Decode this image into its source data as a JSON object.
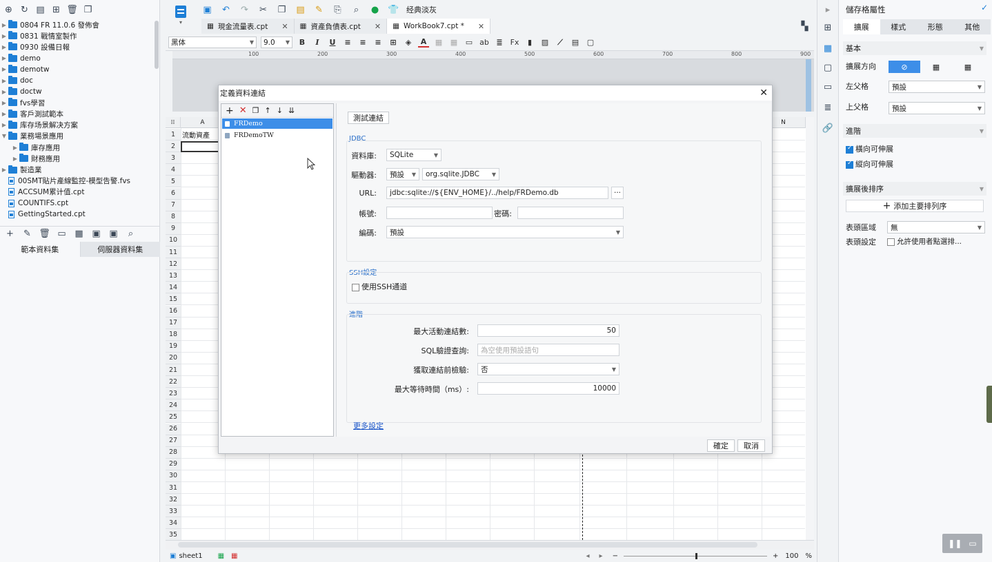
{
  "tree": {
    "items": [
      {
        "label": "0804 FR 11.0.6 發佈會",
        "type": "folder",
        "indent": 0
      },
      {
        "label": "0831 戰情室製作",
        "type": "folder",
        "indent": 0
      },
      {
        "label": "0930 設備日報",
        "type": "folder",
        "indent": 0
      },
      {
        "label": "demo",
        "type": "folder",
        "indent": 0
      },
      {
        "label": "demotw",
        "type": "folder",
        "indent": 0
      },
      {
        "label": "doc",
        "type": "folder",
        "indent": 0
      },
      {
        "label": "doctw",
        "type": "folder",
        "indent": 0
      },
      {
        "label": "fvs學習",
        "type": "folder",
        "indent": 0
      },
      {
        "label": "客戶測試範本",
        "type": "folder",
        "indent": 0
      },
      {
        "label": "库存场景解决方案",
        "type": "folder",
        "indent": 0
      },
      {
        "label": "業務場景應用",
        "type": "folder",
        "indent": 0,
        "expanded": true
      },
      {
        "label": "庫存應用",
        "type": "folder",
        "indent": 1
      },
      {
        "label": "財務應用",
        "type": "folder",
        "indent": 1
      },
      {
        "label": "製造業",
        "type": "folder",
        "indent": 0
      },
      {
        "label": "00SMT貼片產線監控-模型告警.fvs",
        "type": "file",
        "indent": 0
      },
      {
        "label": "ACCSUM累计值.cpt",
        "type": "file",
        "indent": 0
      },
      {
        "label": "COUNTIFS.cpt",
        "type": "file",
        "indent": 0
      },
      {
        "label": "GettingStarted.cpt",
        "type": "file",
        "indent": 0
      }
    ]
  },
  "dataset_tabs": {
    "template": "範本資料集",
    "server": "伺服器資料集"
  },
  "toolbar": {
    "classic_skin": "经典淡灰"
  },
  "tabs": [
    {
      "label": "現金流量表.cpt",
      "active": false
    },
    {
      "label": "資產負債表.cpt",
      "active": false
    },
    {
      "label": "WorkBook7.cpt *",
      "active": true
    }
  ],
  "format": {
    "font": "黑体",
    "size": "9.0",
    "bold": "B",
    "italic": "I",
    "underline": "U"
  },
  "ruler": {
    "marks": [
      "100",
      "200",
      "300",
      "400",
      "500",
      "600",
      "700",
      "800",
      "900",
      "100"
    ]
  },
  "grid": {
    "columns": [
      "A",
      "N"
    ],
    "rows": [
      "1",
      "2",
      "3",
      "4",
      "5",
      "6",
      "7",
      "8",
      "9",
      "10",
      "11",
      "12",
      "13",
      "14",
      "15",
      "16",
      "17",
      "18",
      "19",
      "20",
      "21",
      "22",
      "23",
      "24",
      "25",
      "26",
      "27",
      "28",
      "29",
      "30",
      "31",
      "32",
      "33",
      "34",
      "35"
    ],
    "cell_a1": "流動資產"
  },
  "sheet_tab": "sheet1",
  "zoom": {
    "value": "100",
    "unit": "%"
  },
  "right_panel": {
    "title": "儲存格屬性",
    "tabs": [
      "擴展",
      "樣式",
      "形態",
      "其他"
    ],
    "basic": {
      "title": "基本",
      "direction_label": "擴展方向",
      "left_parent_label": "左父格",
      "left_parent_value": "預設",
      "upper_parent_label": "上父格",
      "upper_parent_value": "預設"
    },
    "advanced": {
      "title": "進階",
      "horizontal": "橫向可伸展",
      "vertical": "縱向可伸展"
    },
    "sort": {
      "title": "擴展後排序",
      "add_button": "添加主要排列序",
      "header_area_label": "表頭區域",
      "header_area_value": "無",
      "header_setting_label": "表頭設定",
      "header_setting_option": "允許使用者點選排..."
    }
  },
  "dialog": {
    "title": "定義資料連結",
    "connections": [
      {
        "name": "FRDemo",
        "selected": true
      },
      {
        "name": "FRDemoTW",
        "selected": false
      }
    ],
    "test_button": "測試連結",
    "jdbc": {
      "title": "JDBC",
      "db_label": "資料庫:",
      "db_value": "SQLite",
      "driver_label": "驅動器:",
      "driver_mode": "預設",
      "driver_value": "org.sqlite.JDBC",
      "url_label": "URL:",
      "url_value": "jdbc:sqlite://${ENV_HOME}/../help/FRDemo.db",
      "url_more": "···",
      "user_label": "帳號:",
      "user_value": "",
      "password_label": "密碼:",
      "password_value": "",
      "encoding_label": "編碼:",
      "encoding_value": "預設"
    },
    "ssh": {
      "title": "SSH設定",
      "use_ssh": "使用SSH通道"
    },
    "advanced": {
      "title": "進階",
      "max_active_label": "最大活動連結數:",
      "max_active_value": "50",
      "validation_label": "SQL驗證查詢:",
      "validation_placeholder": "為空使用預設語句",
      "test_before_label": "獲取連結前檢驗:",
      "test_before_value": "否",
      "max_wait_label": "最大等待時間（ms）:",
      "max_wait_value": "10000",
      "more_settings": "更多設定"
    },
    "ok": "確定",
    "cancel": "取消"
  },
  "colors": {
    "accent": "#1e7fd6",
    "selection": "#3d8ee8",
    "link": "#1a55c9"
  }
}
